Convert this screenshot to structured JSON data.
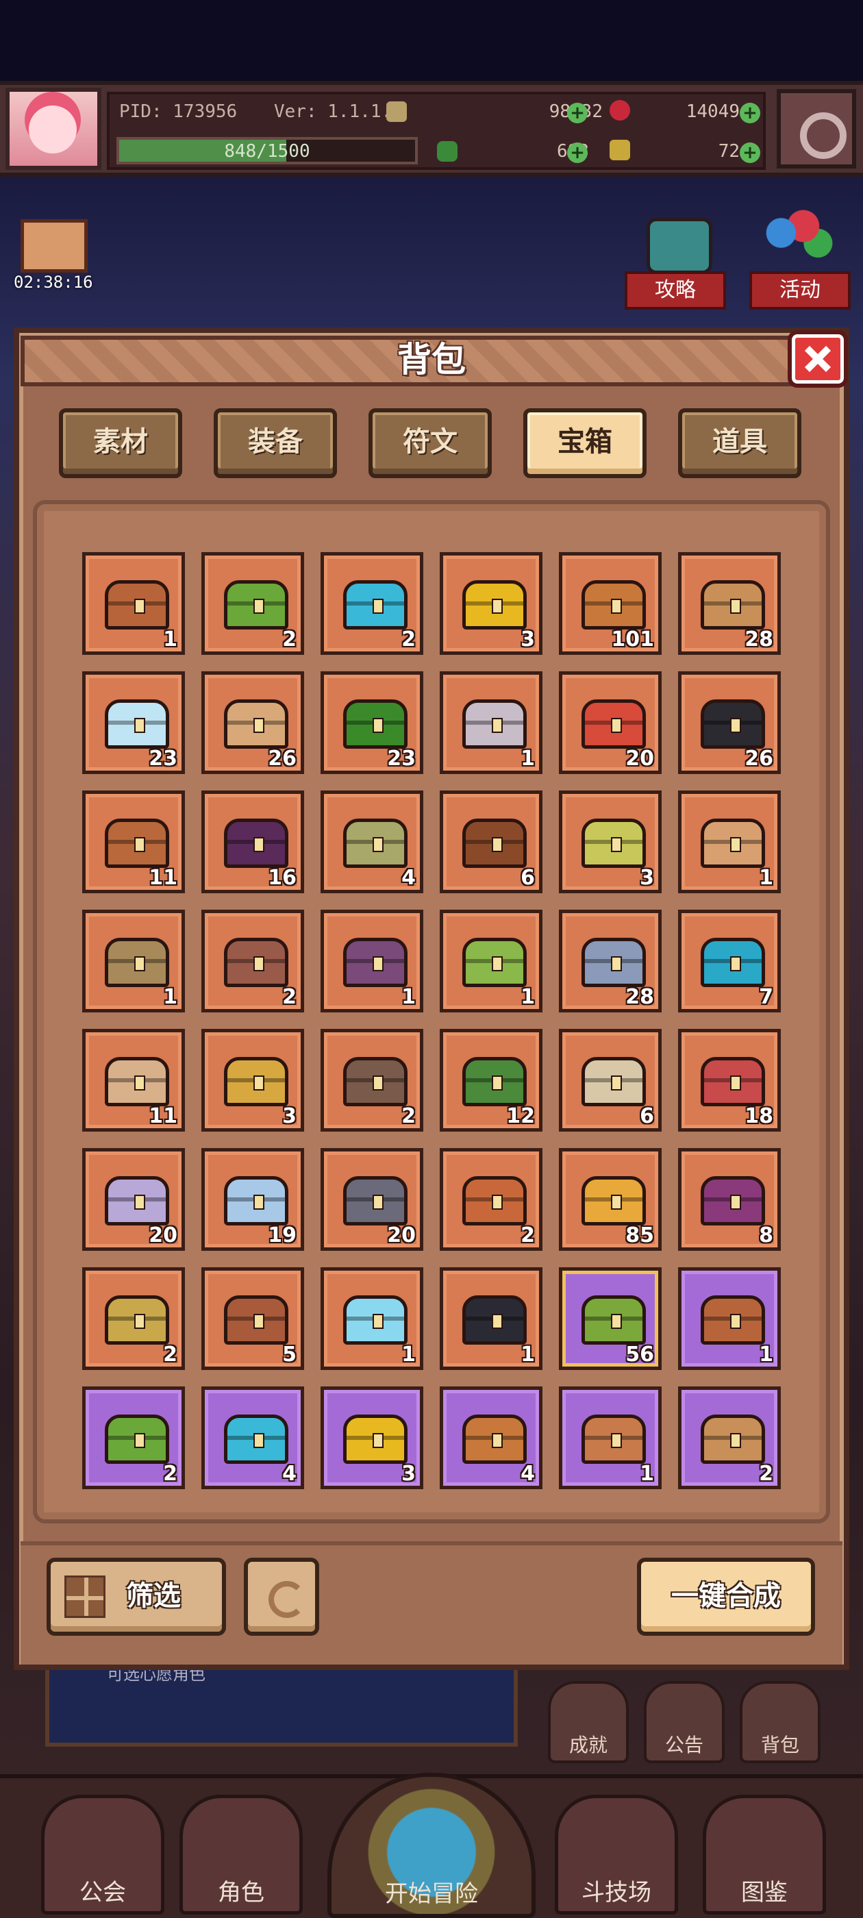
{
  "status": {
    "pid": "PID: 173956",
    "version": "Ver: 1.1.1.6",
    "gold": "98432",
    "gems": "14049",
    "clover": "683",
    "keys": "72",
    "xp_text": "848/1500",
    "xp_fraction": 0.565
  },
  "side": {
    "gift_timer": "02:38:16",
    "guide_label": "攻略",
    "event_label": "活动"
  },
  "modal": {
    "title": "背包",
    "tabs": [
      {
        "label": "素材",
        "active": false
      },
      {
        "label": "装备",
        "active": false
      },
      {
        "label": "符文",
        "active": false
      },
      {
        "label": "宝箱",
        "active": true
      },
      {
        "label": "道具",
        "active": false
      }
    ],
    "items": [
      {
        "icon": "wooden-chest-icon",
        "color": "#b8643a",
        "count": "1",
        "rarity": "common"
      },
      {
        "icon": "green-chest-icon",
        "color": "#6aa83a",
        "count": "2",
        "rarity": "common"
      },
      {
        "icon": "blue-chest-icon",
        "color": "#3ab8d8",
        "count": "2",
        "rarity": "common"
      },
      {
        "icon": "gold-chest-icon",
        "color": "#e8b820",
        "count": "3",
        "rarity": "common"
      },
      {
        "icon": "bronze-chest-icon",
        "color": "#c8783a",
        "count": "101",
        "rarity": "common"
      },
      {
        "icon": "basket-icon",
        "color": "#c89058",
        "count": "28",
        "rarity": "common"
      },
      {
        "icon": "crystal-chest-icon",
        "color": "#bfe4f4",
        "count": "23",
        "rarity": "common"
      },
      {
        "icon": "horned-chest-icon",
        "color": "#d8a878",
        "count": "26",
        "rarity": "common"
      },
      {
        "icon": "leaf-chest-icon",
        "color": "#3a8a2a",
        "count": "23",
        "rarity": "common"
      },
      {
        "icon": "stone-icon",
        "color": "#c8bcc8",
        "count": "1",
        "rarity": "common"
      },
      {
        "icon": "mushroom-chest-icon",
        "color": "#d84a3a",
        "count": "20",
        "rarity": "common"
      },
      {
        "icon": "black-chest-icon",
        "color": "#2a2a30",
        "count": "26",
        "rarity": "common"
      },
      {
        "icon": "backpack-icon",
        "color": "#b8683a",
        "count": "11",
        "rarity": "common"
      },
      {
        "icon": "dark-crystal-icon",
        "color": "#5a2a5a",
        "count": "16",
        "rarity": "common"
      },
      {
        "icon": "olive-chest-icon",
        "color": "#a8a86a",
        "count": "4",
        "rarity": "common"
      },
      {
        "icon": "adventurer-pack-icon",
        "color": "#8a4a2a",
        "count": "6",
        "rarity": "common"
      },
      {
        "icon": "sun-chest-icon",
        "color": "#c8c85a",
        "count": "3",
        "rarity": "common"
      },
      {
        "icon": "cardboard-box-icon",
        "color": "#d8a070",
        "count": "1",
        "rarity": "common"
      },
      {
        "icon": "shell-chest-icon",
        "color": "#a88a5a",
        "count": "1",
        "rarity": "common"
      },
      {
        "icon": "mixed-chest-icon",
        "color": "#9a5a4a",
        "count": "2",
        "rarity": "common"
      },
      {
        "icon": "purple-chest-icon",
        "color": "#7a4a7a",
        "count": "1",
        "rarity": "common"
      },
      {
        "icon": "turtle-chest-icon",
        "color": "#8ab84a",
        "count": "1",
        "rarity": "common"
      },
      {
        "icon": "silver-chest-icon",
        "color": "#8a9ab8",
        "count": "28",
        "rarity": "common"
      },
      {
        "icon": "ocean-chest-icon",
        "color": "#2aa8c8",
        "count": "7",
        "rarity": "common"
      },
      {
        "icon": "bone-chest-icon",
        "color": "#d8b08a",
        "count": "11",
        "rarity": "common"
      },
      {
        "icon": "golden-horn-chest-icon",
        "color": "#d8a840",
        "count": "3",
        "rarity": "common"
      },
      {
        "icon": "rock-chest-icon",
        "color": "#7a5a4a",
        "count": "2",
        "rarity": "common"
      },
      {
        "icon": "jungle-chest-icon",
        "color": "#4a8a3a",
        "count": "12",
        "rarity": "common"
      },
      {
        "icon": "sand-chest-icon",
        "color": "#d8c8a8",
        "count": "6",
        "rarity": "common"
      },
      {
        "icon": "flag-chest-icon",
        "color": "#c84a4a",
        "count": "18",
        "rarity": "common"
      },
      {
        "icon": "pink-silver-chest-icon",
        "color": "#b8a8d8",
        "count": "20",
        "rarity": "common"
      },
      {
        "icon": "ice-silver-chest-icon",
        "color": "#a8c8e8",
        "count": "19",
        "rarity": "common"
      },
      {
        "icon": "iron-chest-icon",
        "color": "#6a6a7a",
        "count": "20",
        "rarity": "common"
      },
      {
        "icon": "medal-chest-icon",
        "color": "#c8683a",
        "count": "2",
        "rarity": "common"
      },
      {
        "icon": "crown-chest-icon",
        "color": "#e8a83a",
        "count": "85",
        "rarity": "common"
      },
      {
        "icon": "royal-chest-icon",
        "color": "#8a3a7a",
        "count": "8",
        "rarity": "common"
      },
      {
        "icon": "clover-chest-icon",
        "color": "#c8a84a",
        "count": "2",
        "rarity": "common"
      },
      {
        "icon": "sack-icon",
        "color": "#a85a3a",
        "count": "5",
        "rarity": "common"
      },
      {
        "icon": "glacier-chest-icon",
        "color": "#8ad8f0",
        "count": "1",
        "rarity": "common"
      },
      {
        "icon": "obsidian-chest-icon",
        "color": "#2a2a34",
        "count": "1",
        "rarity": "common"
      },
      {
        "icon": "zongzi-icon",
        "color": "#7aa83a",
        "count": "56",
        "rarity": "gold-rim"
      },
      {
        "icon": "wooden-chest-icon",
        "color": "#b8643a",
        "count": "1",
        "rarity": "rare"
      },
      {
        "icon": "green-chest-icon",
        "color": "#6aa83a",
        "count": "2",
        "rarity": "rare"
      },
      {
        "icon": "blue-chest-icon",
        "color": "#3ab8d8",
        "count": "4",
        "rarity": "rare"
      },
      {
        "icon": "gold-chest-icon",
        "color": "#e8b820",
        "count": "3",
        "rarity": "rare"
      },
      {
        "icon": "bronze-chest-icon",
        "color": "#c8783a",
        "count": "4",
        "rarity": "rare"
      },
      {
        "icon": "crate-icon",
        "color": "#c87a4a",
        "count": "1",
        "rarity": "rare"
      },
      {
        "icon": "basket-icon",
        "color": "#c89058",
        "count": "2",
        "rarity": "rare"
      }
    ],
    "filter_label": "筛选",
    "combine_label": "一键合成"
  },
  "background": {
    "banner_text": "可选心愿角色",
    "small_nav": [
      "成就",
      "公告",
      "背包"
    ],
    "nav": {
      "guild": "公会",
      "character": "角色",
      "adventure": "开始冒险",
      "arena": "斗技场",
      "codex": "图鉴"
    }
  }
}
